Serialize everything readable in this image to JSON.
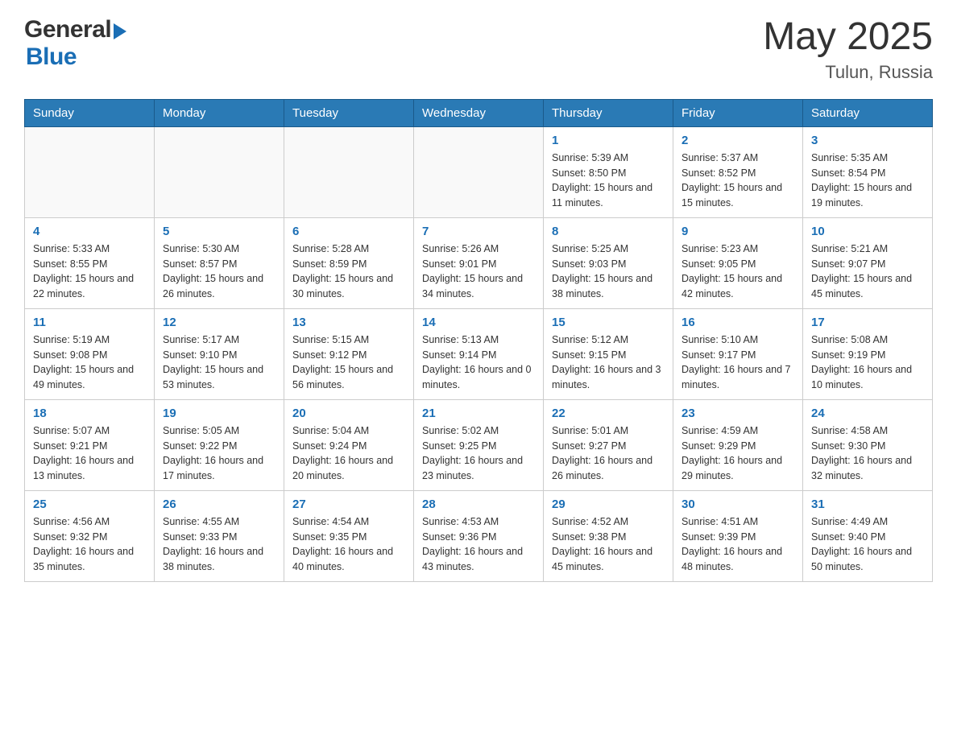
{
  "header": {
    "logo_general": "General",
    "logo_blue": "Blue",
    "month_year": "May 2025",
    "location": "Tulun, Russia"
  },
  "calendar": {
    "days_of_week": [
      "Sunday",
      "Monday",
      "Tuesday",
      "Wednesday",
      "Thursday",
      "Friday",
      "Saturday"
    ],
    "weeks": [
      [
        {
          "day": "",
          "info": ""
        },
        {
          "day": "",
          "info": ""
        },
        {
          "day": "",
          "info": ""
        },
        {
          "day": "",
          "info": ""
        },
        {
          "day": "1",
          "info": "Sunrise: 5:39 AM\nSunset: 8:50 PM\nDaylight: 15 hours and 11 minutes."
        },
        {
          "day": "2",
          "info": "Sunrise: 5:37 AM\nSunset: 8:52 PM\nDaylight: 15 hours and 15 minutes."
        },
        {
          "day": "3",
          "info": "Sunrise: 5:35 AM\nSunset: 8:54 PM\nDaylight: 15 hours and 19 minutes."
        }
      ],
      [
        {
          "day": "4",
          "info": "Sunrise: 5:33 AM\nSunset: 8:55 PM\nDaylight: 15 hours and 22 minutes."
        },
        {
          "day": "5",
          "info": "Sunrise: 5:30 AM\nSunset: 8:57 PM\nDaylight: 15 hours and 26 minutes."
        },
        {
          "day": "6",
          "info": "Sunrise: 5:28 AM\nSunset: 8:59 PM\nDaylight: 15 hours and 30 minutes."
        },
        {
          "day": "7",
          "info": "Sunrise: 5:26 AM\nSunset: 9:01 PM\nDaylight: 15 hours and 34 minutes."
        },
        {
          "day": "8",
          "info": "Sunrise: 5:25 AM\nSunset: 9:03 PM\nDaylight: 15 hours and 38 minutes."
        },
        {
          "day": "9",
          "info": "Sunrise: 5:23 AM\nSunset: 9:05 PM\nDaylight: 15 hours and 42 minutes."
        },
        {
          "day": "10",
          "info": "Sunrise: 5:21 AM\nSunset: 9:07 PM\nDaylight: 15 hours and 45 minutes."
        }
      ],
      [
        {
          "day": "11",
          "info": "Sunrise: 5:19 AM\nSunset: 9:08 PM\nDaylight: 15 hours and 49 minutes."
        },
        {
          "day": "12",
          "info": "Sunrise: 5:17 AM\nSunset: 9:10 PM\nDaylight: 15 hours and 53 minutes."
        },
        {
          "day": "13",
          "info": "Sunrise: 5:15 AM\nSunset: 9:12 PM\nDaylight: 15 hours and 56 minutes."
        },
        {
          "day": "14",
          "info": "Sunrise: 5:13 AM\nSunset: 9:14 PM\nDaylight: 16 hours and 0 minutes."
        },
        {
          "day": "15",
          "info": "Sunrise: 5:12 AM\nSunset: 9:15 PM\nDaylight: 16 hours and 3 minutes."
        },
        {
          "day": "16",
          "info": "Sunrise: 5:10 AM\nSunset: 9:17 PM\nDaylight: 16 hours and 7 minutes."
        },
        {
          "day": "17",
          "info": "Sunrise: 5:08 AM\nSunset: 9:19 PM\nDaylight: 16 hours and 10 minutes."
        }
      ],
      [
        {
          "day": "18",
          "info": "Sunrise: 5:07 AM\nSunset: 9:21 PM\nDaylight: 16 hours and 13 minutes."
        },
        {
          "day": "19",
          "info": "Sunrise: 5:05 AM\nSunset: 9:22 PM\nDaylight: 16 hours and 17 minutes."
        },
        {
          "day": "20",
          "info": "Sunrise: 5:04 AM\nSunset: 9:24 PM\nDaylight: 16 hours and 20 minutes."
        },
        {
          "day": "21",
          "info": "Sunrise: 5:02 AM\nSunset: 9:25 PM\nDaylight: 16 hours and 23 minutes."
        },
        {
          "day": "22",
          "info": "Sunrise: 5:01 AM\nSunset: 9:27 PM\nDaylight: 16 hours and 26 minutes."
        },
        {
          "day": "23",
          "info": "Sunrise: 4:59 AM\nSunset: 9:29 PM\nDaylight: 16 hours and 29 minutes."
        },
        {
          "day": "24",
          "info": "Sunrise: 4:58 AM\nSunset: 9:30 PM\nDaylight: 16 hours and 32 minutes."
        }
      ],
      [
        {
          "day": "25",
          "info": "Sunrise: 4:56 AM\nSunset: 9:32 PM\nDaylight: 16 hours and 35 minutes."
        },
        {
          "day": "26",
          "info": "Sunrise: 4:55 AM\nSunset: 9:33 PM\nDaylight: 16 hours and 38 minutes."
        },
        {
          "day": "27",
          "info": "Sunrise: 4:54 AM\nSunset: 9:35 PM\nDaylight: 16 hours and 40 minutes."
        },
        {
          "day": "28",
          "info": "Sunrise: 4:53 AM\nSunset: 9:36 PM\nDaylight: 16 hours and 43 minutes."
        },
        {
          "day": "29",
          "info": "Sunrise: 4:52 AM\nSunset: 9:38 PM\nDaylight: 16 hours and 45 minutes."
        },
        {
          "day": "30",
          "info": "Sunrise: 4:51 AM\nSunset: 9:39 PM\nDaylight: 16 hours and 48 minutes."
        },
        {
          "day": "31",
          "info": "Sunrise: 4:49 AM\nSunset: 9:40 PM\nDaylight: 16 hours and 50 minutes."
        }
      ]
    ]
  }
}
